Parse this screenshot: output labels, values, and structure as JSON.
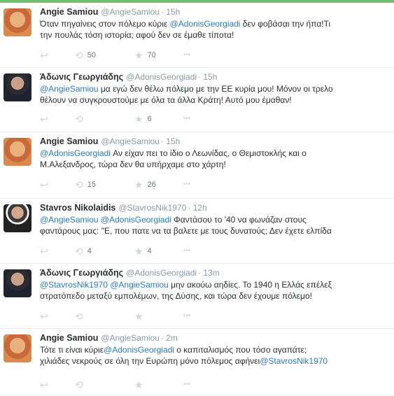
{
  "tweets": [
    {
      "name": "Angie Samiou",
      "handle": "@AngieSamiou",
      "time": "· 15h",
      "avatar": "angie",
      "line1": [
        {
          "t": "Όταν πηγαίνεις στον πόλεμο κύριε "
        },
        {
          "t": "@AdonisGeorgiadi",
          "m": true
        },
        {
          "t": " δεν φοβάσαι την ήπα!Τι"
        }
      ],
      "line2": [
        {
          "t": "την πουλάς τόση ιστορία; αφού δεν σε έμαθε τίποτα!"
        }
      ],
      "retweets": "50",
      "favorites": "70"
    },
    {
      "name": "Άδωνις Γεωργιάδης",
      "handle": "@AdonisGeorgiadi",
      "time": "· 15h",
      "avatar": "adonis",
      "line1": [
        {
          "t": "@AngieSamiou",
          "m": true
        },
        {
          "t": " μα εγώ δεν θέλω πόλεμο με την ΕΕ κυρία μου! Μόνον οι τρελο"
        }
      ],
      "line2": [
        {
          "t": "θέλουν να συγκρουστούμε με όλα τα άλλα Κράτη! Αυτό μου έμαθαν!"
        }
      ],
      "retweets": "",
      "favorites": "6"
    },
    {
      "name": "Angie Samiou",
      "handle": "@AngieSamiou",
      "time": "· 15h",
      "avatar": "angie",
      "line1": [
        {
          "t": "@AdonisGeorgiadi",
          "m": true
        },
        {
          "t": " Αν είχαν πει το ίδιο ο Λεωνίδας, ο Θεμιστοκλής και ο"
        }
      ],
      "line2": [
        {
          "t": "Μ.Αλεξανδρος, τώρα δεν θα υπήρχαμε στο χάρτη!"
        }
      ],
      "retweets": "15",
      "favorites": "26"
    },
    {
      "name": "Stavros Nikolaidis",
      "handle": "@StavrosNik1970",
      "time": "· 12h",
      "avatar": "stavros",
      "line1": [
        {
          "t": "@AngieSamiou",
          "m": true
        },
        {
          "t": " "
        },
        {
          "t": "@AdonisGeorgiadi",
          "m": true
        },
        {
          "t": " Φαντάσου το '40 να φωνάζαν στους"
        }
      ],
      "line2": [
        {
          "t": "φαντάρους μας: \"Ε, που πατε να τα βαλετε με τους δυνατούς; Δεν έχετε ελπίδα"
        }
      ],
      "retweets": "4",
      "favorites": "4"
    },
    {
      "name": "Άδωνις Γεωργιάδης",
      "handle": "@AdonisGeorgiadi",
      "time": "· 13m",
      "avatar": "adonis",
      "line1": [
        {
          "t": "@StavrosNik1970",
          "m": true
        },
        {
          "t": " "
        },
        {
          "t": "@AngieSamiou",
          "m": true
        },
        {
          "t": " μην ακούω αηδίες. Το 1940 η Ελλάς επέλεξ"
        }
      ],
      "line2": [
        {
          "t": "στρατόπεδο μεταξύ εμπολέμων, της Δύσης, και τώρα δεν έχουμε πόλεμο!"
        }
      ],
      "retweets": "",
      "favorites": ""
    },
    {
      "name": "Angie Samiou",
      "handle": "@AngieSamiou",
      "time": "· 2m",
      "avatar": "angie",
      "line1": [
        {
          "t": "Τότε τι είναι κύριε"
        },
        {
          "t": "@AdonisGeorgiadi",
          "m": true
        },
        {
          "t": " ο καπιταλισμός που τόσο αγαπάτε;"
        }
      ],
      "line2": [
        {
          "t": "χιλιάδες νεκρούς σε όλη την Ευρώπη μόνο πόλεμος αφήνει"
        },
        {
          "t": "@StavrosNik1970",
          "m": true
        }
      ],
      "retweets": "",
      "favorites": ""
    }
  ],
  "icons": {
    "reply": "reply-icon",
    "retweet": "retweet-icon",
    "favorite": "star-icon",
    "more": "more-icon"
  },
  "colors": {
    "accent": "#2b7bb9",
    "thread": "#7cc08f",
    "muted": "#8899a6"
  }
}
